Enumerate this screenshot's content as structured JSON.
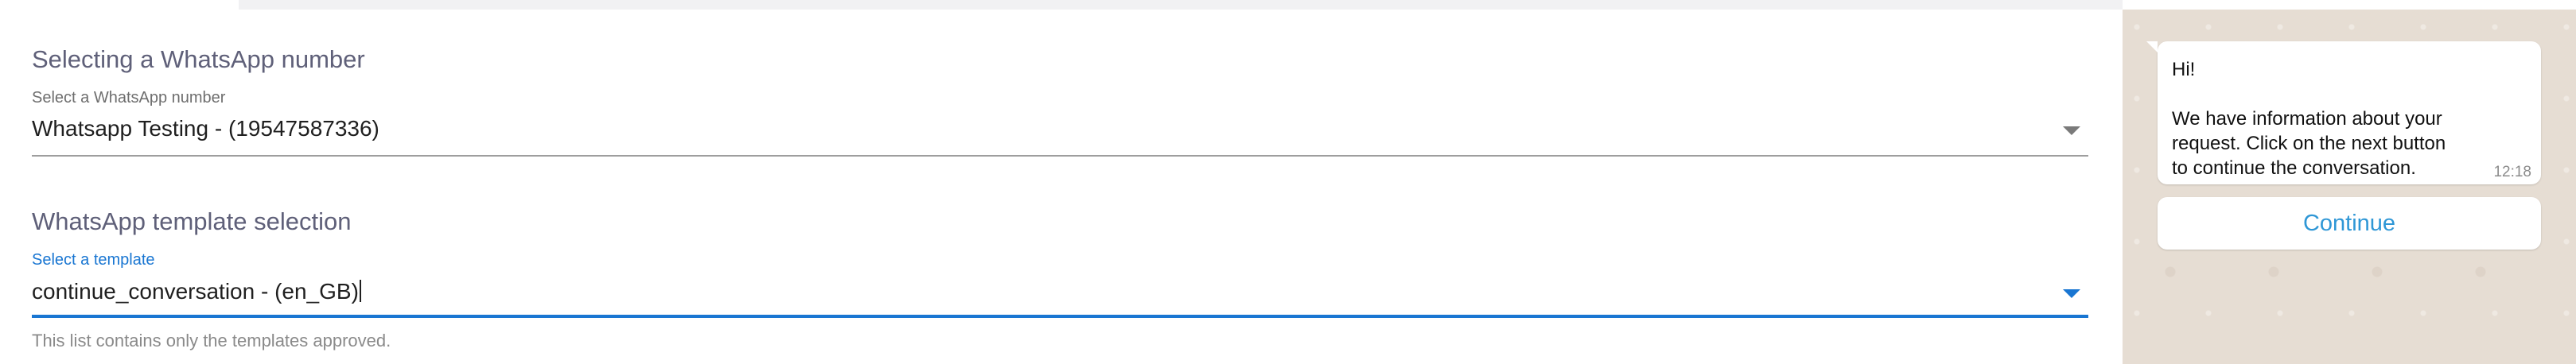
{
  "number_section": {
    "title": "Selecting a WhatsApp number",
    "label": "Select a WhatsApp number",
    "value": "Whatsapp Testing - (19547587336)"
  },
  "template_section": {
    "title": "WhatsApp template selection",
    "label": "Select a template",
    "value": "continue_conversation - (en_GB)",
    "helper": "This list contains only the templates approved."
  },
  "preview": {
    "greeting": "Hi!",
    "body_lines": [
      "We have information about your",
      "request. Click on the next button",
      "to continue the conversation."
    ],
    "time": "12:18",
    "button_label": "Continue"
  },
  "icons": {
    "number_dropdown": "chevron-down-icon",
    "template_dropdown": "chevron-down-icon"
  },
  "colors": {
    "accent": "#1976d2",
    "button_text": "#2f97d6",
    "chat_background": "#e6ddd3"
  }
}
